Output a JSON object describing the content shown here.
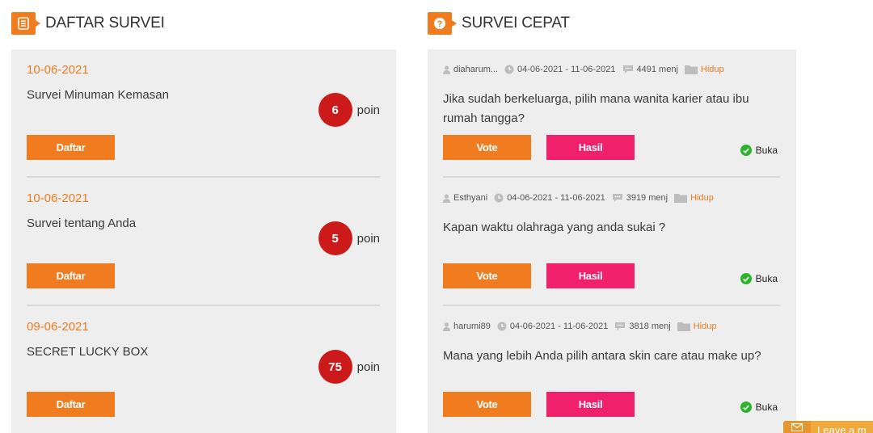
{
  "left_section": {
    "title": "DAFTAR SURVEI",
    "icon": "list-icon",
    "items": [
      {
        "date": "10-06-2021",
        "name": "Survei Minuman Kemasan",
        "points": "6",
        "points_label": "poin",
        "button": "Daftar"
      },
      {
        "date": "10-06-2021",
        "name": "Survei tentang Anda",
        "points": "5",
        "points_label": "poin",
        "button": "Daftar"
      },
      {
        "date": "09-06-2021",
        "name": "SECRET LUCKY BOX",
        "points": "75",
        "points_label": "poin",
        "button": "Daftar"
      }
    ]
  },
  "right_section": {
    "title": "SURVEI CEPAT",
    "icon": "question-icon",
    "polls": [
      {
        "user": "diaharum...",
        "period": "04-06-2021 - 11-06-2021",
        "responses": "4491 menj",
        "category": "Hidup",
        "question": "Jika sudah berkeluarga, pilih mana wanita karier atau ibu rumah tangga?",
        "vote_label": "Vote",
        "result_label": "Hasil",
        "status": "Buka"
      },
      {
        "user": "Esthyani",
        "period": "04-06-2021 - 11-06-2021",
        "responses": "3919 menj",
        "category": "Hidup",
        "question": "Kapan waktu olahraga yang anda sukai ?",
        "vote_label": "Vote",
        "result_label": "Hasil",
        "status": "Buka"
      },
      {
        "user": "harumi89",
        "period": "04-06-2021 - 11-06-2021",
        "responses": "3818 menj",
        "category": "Hidup",
        "question": "Mana yang lebih Anda pilih antara skin care atau make up?",
        "vote_label": "Vote",
        "result_label": "Hasil",
        "status": "Buka"
      }
    ]
  },
  "leave_message": {
    "label": "Leave a m"
  },
  "colors": {
    "accent": "#f07c1f",
    "points": "#cc1a1a",
    "result": "#f0206a",
    "open": "#2bb42b",
    "panel": "#eeeeee"
  }
}
